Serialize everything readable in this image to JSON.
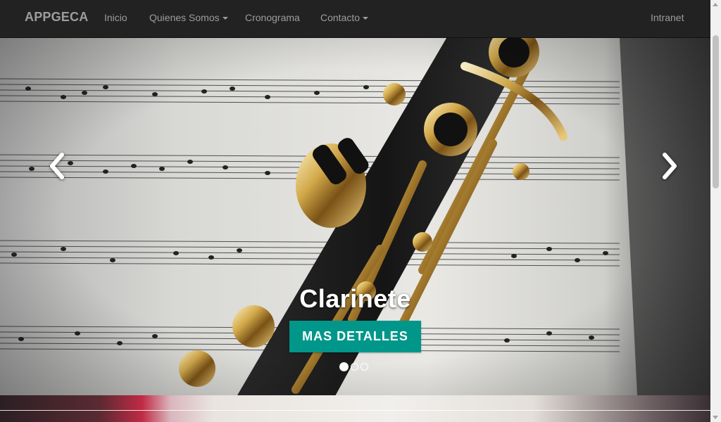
{
  "navbar": {
    "brand": "APPGECA",
    "items": [
      {
        "label": "Inicio",
        "dropdown": false
      },
      {
        "label": "Quienes Somos",
        "dropdown": true
      },
      {
        "label": "Cronograma",
        "dropdown": false
      },
      {
        "label": "Contacto",
        "dropdown": true
      }
    ],
    "right_item": "Intranet",
    "colors": {
      "background": "#222222",
      "text": "#9d9d9d"
    }
  },
  "carousel": {
    "caption_title": "Clarinete",
    "button_label": "MAS DETALLES",
    "button_color": "#00978a",
    "slides": 3,
    "active_slide": 1,
    "prev_icon": "chevron-left-icon",
    "next_icon": "chevron-right-icon",
    "image": "clarinet-on-sheet-music"
  }
}
